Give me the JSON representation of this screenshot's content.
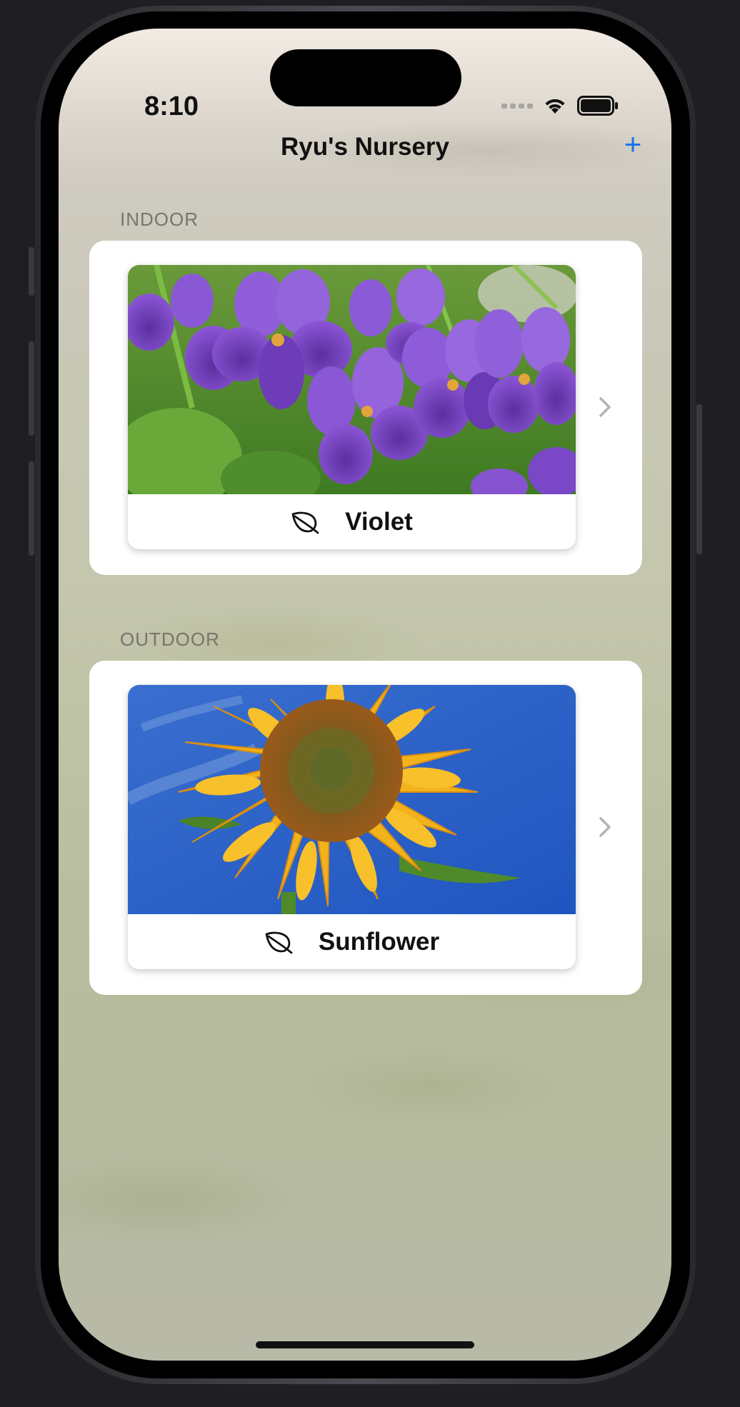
{
  "status_bar": {
    "time": "8:10"
  },
  "nav": {
    "title": "Ryu's Nursery",
    "add_label": "+"
  },
  "sections": [
    {
      "header": "INDOOR",
      "plant": {
        "name": "Violet",
        "icon": "leaf-icon",
        "photo": "violet-flowers-photo"
      }
    },
    {
      "header": "OUTDOOR",
      "plant": {
        "name": "Sunflower",
        "icon": "leaf-icon",
        "photo": "sunflower-photo"
      }
    }
  ],
  "colors": {
    "accent": "#1a73e8",
    "card_background": "#ffffff",
    "section_header": "#77746f"
  }
}
